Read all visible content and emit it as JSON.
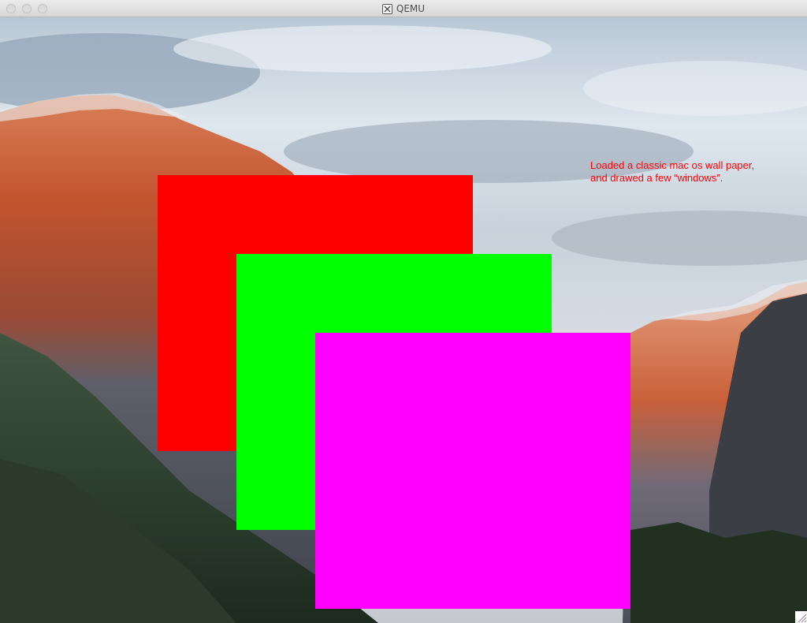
{
  "window": {
    "title": "QEMU",
    "app_icon": "x11-icon"
  },
  "desktop": {
    "wallpaper": "yosemite-el-capitan-wallpaper",
    "note_line1": "Loaded a classic mac os wall paper,",
    "note_line2": "and drawed a few “windows”.",
    "note_color": "#ff0000"
  },
  "fake_windows": [
    {
      "color": "#ff0000"
    },
    {
      "color": "#00ff00"
    },
    {
      "color": "#ff00ff"
    }
  ],
  "colors": {
    "titlebar": "#e4e4e4",
    "title_text": "#4d4d4d"
  }
}
